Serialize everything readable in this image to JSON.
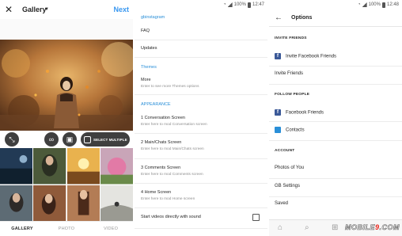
{
  "gallery": {
    "title": "Gallery",
    "next_label": "Next",
    "select_multiple": "SELECT MULTIPLE",
    "tabs": [
      "GALLERY",
      "PHOTO",
      "VIDEO"
    ],
    "icons": [
      "close-icon",
      "chevron-down-icon",
      "crop-icon",
      "infinity-icon",
      "layout-icon",
      "select-multiple-icon"
    ]
  },
  "gbsettings": {
    "status_time": "12:47",
    "status_battery": "100%",
    "section_gb": "gbinstagram",
    "faq": "FAQ",
    "updates": "Updates",
    "section_themes": "Themes",
    "more_title": "More",
    "more_sub": "Enter to see more Themes options",
    "section_appearance": "APPEARANCE",
    "items": [
      {
        "title": "1 Conversation Screen",
        "sub": "Enter here to mod Conversation screen"
      },
      {
        "title": "2 Main/Chats Screen",
        "sub": "Enter here to mod Main/Chats screen"
      },
      {
        "title": "3 Comments Screen",
        "sub": "Enter here to mod Comments screen"
      },
      {
        "title": "4 Home Screen",
        "sub": "Enter here to mod Home screen"
      }
    ],
    "video_sound": "Start videos directly with sound",
    "video_sound_checked": false
  },
  "options": {
    "status_time": "12:48",
    "status_battery": "100%",
    "title": "Options",
    "invite_header": "INVITE FRIENDS",
    "invite_facebook": "Invite Facebook Friends",
    "invite_friends": "Invite Friends",
    "follow_header": "FOLLOW PEOPLE",
    "facebook_friends": "Facebook Friends",
    "contacts": "Contacts",
    "account_header": "ACCOUNT",
    "photos_of_you": "Photos of You",
    "gb_settings": "GB Settings",
    "saved": "Saved",
    "nav_icons": [
      "home-icon",
      "search-icon",
      "add-icon",
      "heart-icon",
      "profile-icon"
    ],
    "watermark_a": "MOBILE",
    "watermark_b": "9",
    "watermark_c": ".COM"
  },
  "colors": {
    "accent_blue": "#3897f0",
    "section_blue": "#2a8fd8",
    "facebook_blue": "#3b5998",
    "text_dark": "#262626",
    "text_muted": "#8e8e8e"
  }
}
